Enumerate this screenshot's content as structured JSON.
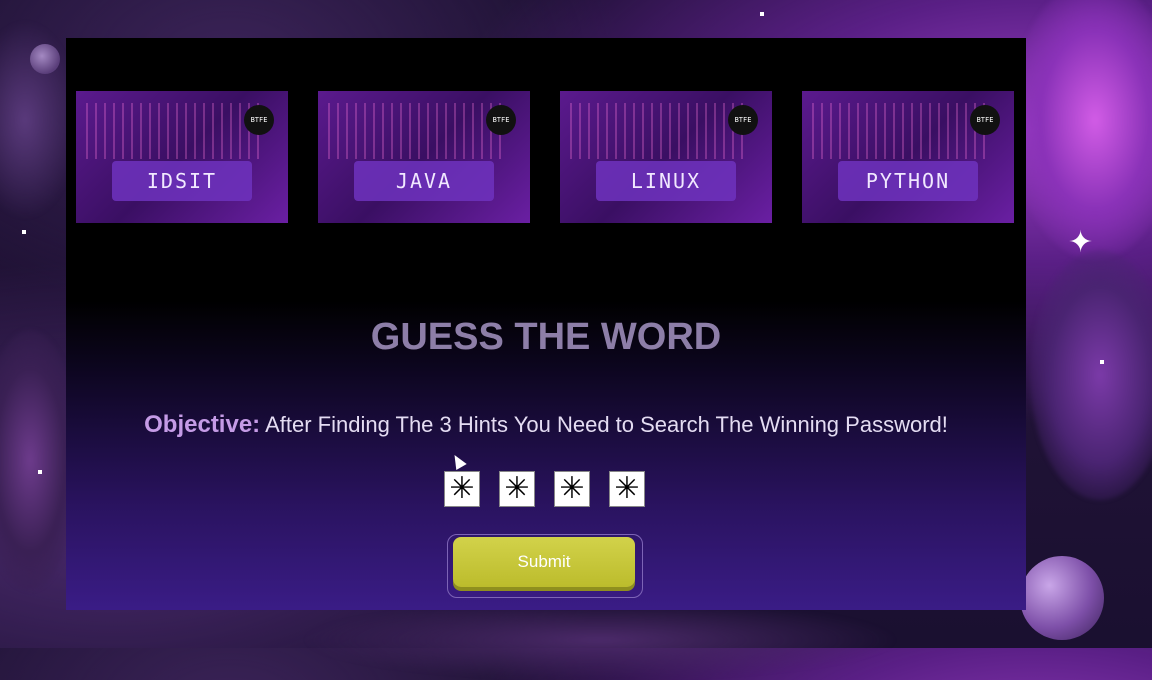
{
  "cards": [
    {
      "label": "IDSIT",
      "badge": "BTFE"
    },
    {
      "label": "JAVA",
      "badge": "BTFE"
    },
    {
      "label": "LINUX",
      "badge": "BTFE"
    },
    {
      "label": "PYTHON",
      "badge": "BTFE"
    }
  ],
  "game": {
    "title": "GUESS THE WORD",
    "objective_key": "Objective:",
    "objective_text": " After Finding The 3 Hints You Need to Search The Winning Password!",
    "password_chars": [
      "✳",
      "✳",
      "✳",
      "✳"
    ],
    "submit_label": "Submit"
  },
  "colors": {
    "title": "#8d7ea8",
    "objective_key": "#c59be6",
    "submit": "#c7c73a"
  }
}
